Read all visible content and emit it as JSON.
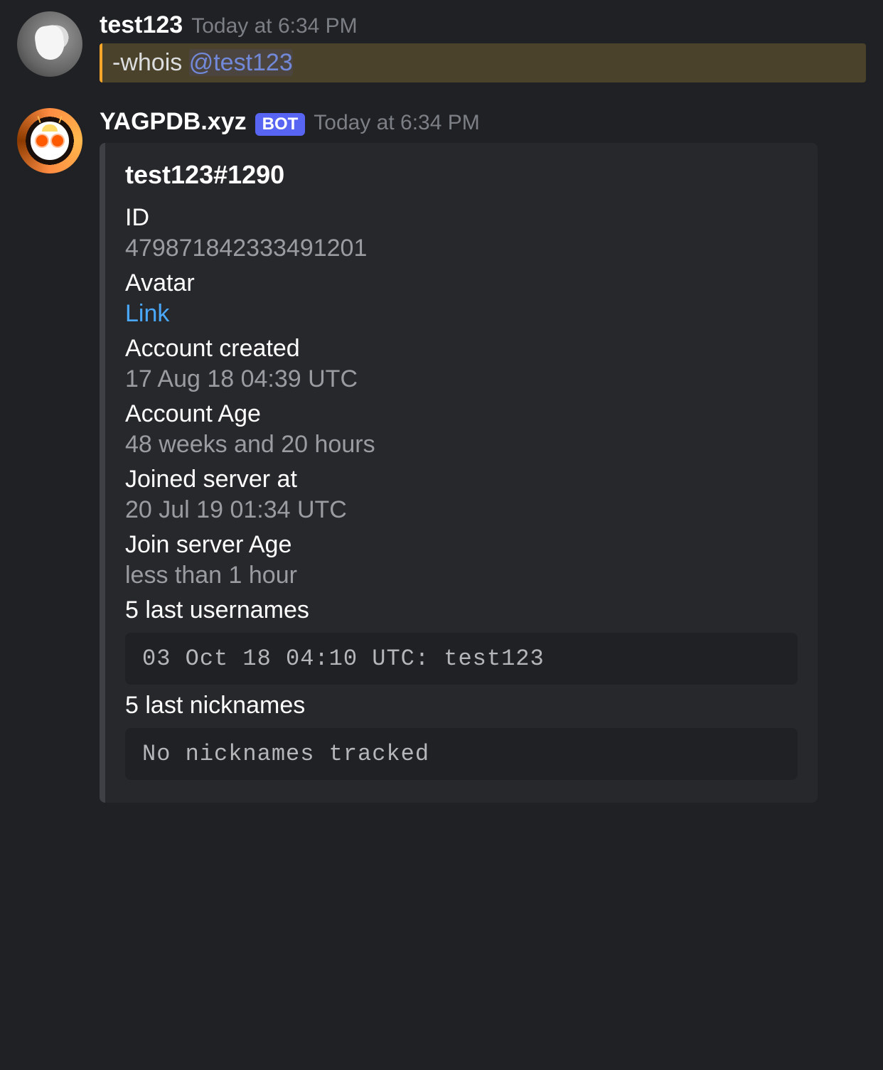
{
  "messages": [
    {
      "author": "test123",
      "timestamp": "Today at 6:34 PM",
      "content": {
        "command": "-whois ",
        "mention": "@test123"
      }
    },
    {
      "author": "YAGPDB.xyz",
      "is_bot": true,
      "bot_badge": "BOT",
      "timestamp": "Today at 6:34 PM",
      "embed": {
        "title": "test123#1290",
        "fields": [
          {
            "name": "ID",
            "value": "479871842333491201"
          },
          {
            "name": "Avatar",
            "value": "Link",
            "link": true
          },
          {
            "name": "Account created",
            "value": "17 Aug 18 04:39 UTC"
          },
          {
            "name": "Account Age",
            "value": "48 weeks and 20 hours"
          },
          {
            "name": "Joined server at",
            "value": "20 Jul 19 01:34 UTC"
          },
          {
            "name": "Join server Age",
            "value": "less than 1 hour"
          },
          {
            "name": "5 last usernames",
            "code": "03 Oct 18 04:10 UTC: test123"
          },
          {
            "name": "5 last nicknames",
            "code": "No nicknames tracked"
          }
        ]
      }
    }
  ]
}
